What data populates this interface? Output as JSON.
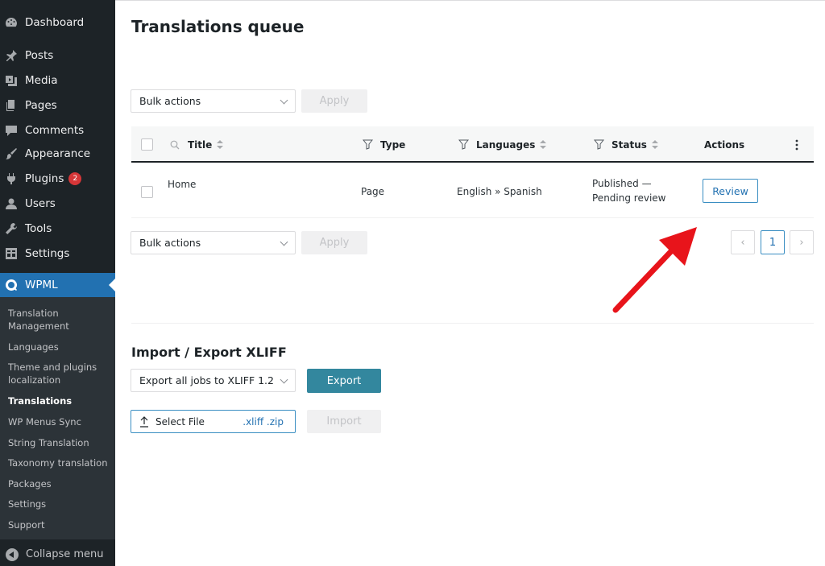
{
  "sidebar": {
    "items": [
      {
        "label": "Dashboard",
        "icon": "dashboard-icon"
      },
      {
        "label": "Posts",
        "icon": "pin-icon"
      },
      {
        "label": "Media",
        "icon": "media-icon"
      },
      {
        "label": "Pages",
        "icon": "pages-icon"
      },
      {
        "label": "Comments",
        "icon": "comment-icon"
      },
      {
        "label": "Appearance",
        "icon": "brush-icon"
      },
      {
        "label": "Plugins",
        "icon": "plugin-icon",
        "badge": "2"
      },
      {
        "label": "Users",
        "icon": "user-icon"
      },
      {
        "label": "Tools",
        "icon": "wrench-icon"
      },
      {
        "label": "Settings",
        "icon": "settings-icon"
      }
    ],
    "wpml": {
      "label": "WPML",
      "icon": "wpml-icon"
    },
    "submenu": [
      {
        "label": "Translation Management"
      },
      {
        "label": "Languages"
      },
      {
        "label": "Theme and plugins localization"
      },
      {
        "label": "Translations",
        "current": true
      },
      {
        "label": "WP Menus Sync"
      },
      {
        "label": "String Translation"
      },
      {
        "label": "Taxonomy translation"
      },
      {
        "label": "Packages"
      },
      {
        "label": "Settings"
      },
      {
        "label": "Support"
      }
    ],
    "collapse_label": "Collapse menu"
  },
  "main": {
    "title": "Translations queue",
    "bulk_top": {
      "select": "Bulk actions",
      "apply": "Apply"
    },
    "bulk_bottom": {
      "select": "Bulk actions",
      "apply": "Apply"
    },
    "table": {
      "headers": {
        "title": "Title",
        "type": "Type",
        "languages": "Languages",
        "status": "Status",
        "actions": "Actions"
      },
      "rows": [
        {
          "title": "Home",
          "type": "Page",
          "languages": "English » Spanish",
          "status": "Published — Pending review",
          "action": "Review"
        }
      ]
    },
    "pagination": {
      "prev": "‹",
      "current": "1",
      "next": "›"
    },
    "xliff": {
      "title": "Import / Export XLIFF",
      "export_select": "Export all jobs to XLIFF 1.2",
      "export_button": "Export",
      "select_file": "Select File",
      "file_ext": ".xliff .zip",
      "import_button": "Import"
    }
  },
  "colors": {
    "sidebar_bg": "#1d2327",
    "wpml_active": "#2271b1",
    "export_btn": "#33879e",
    "arrow": "#e8141b",
    "badge": "#d63638"
  }
}
